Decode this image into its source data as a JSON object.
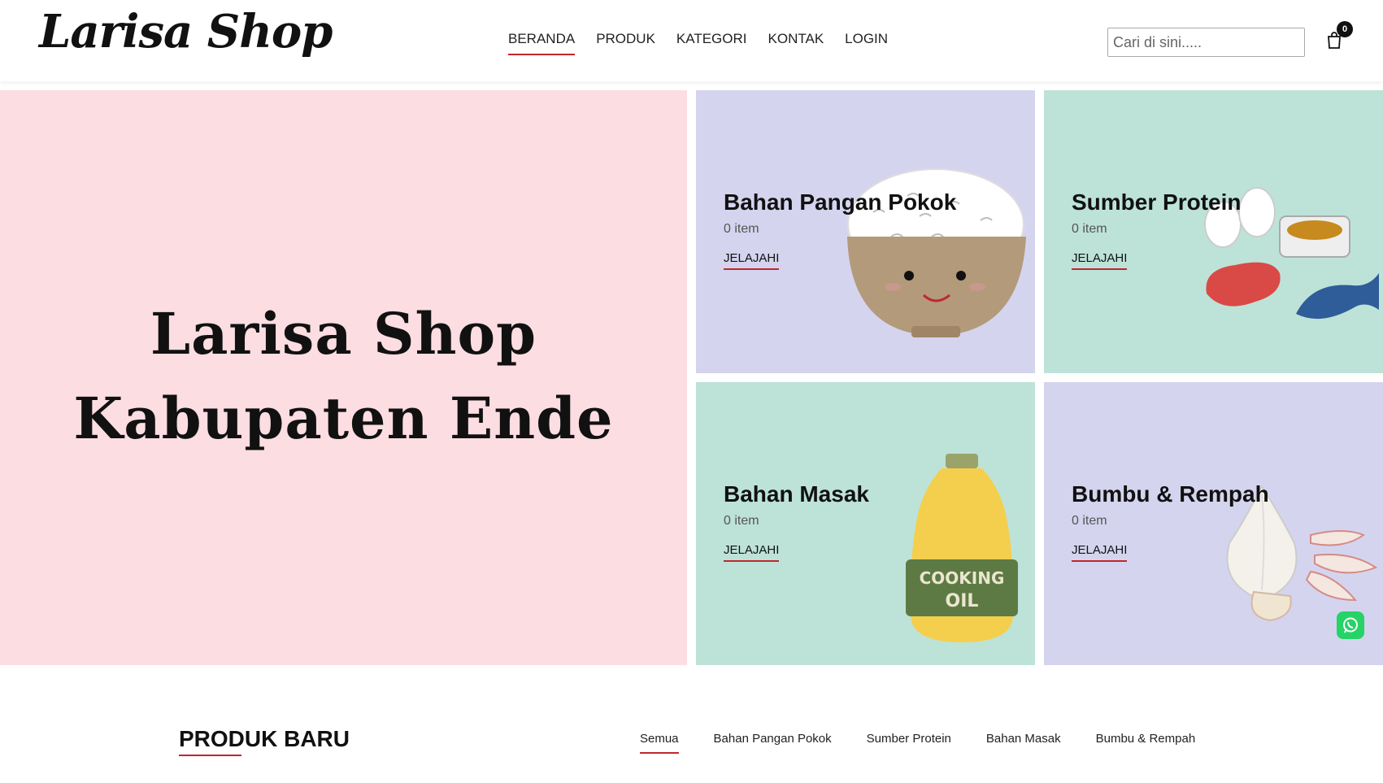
{
  "header": {
    "logo": "Larisa Shop",
    "nav": [
      "BERANDA",
      "PRODUK",
      "KATEGORI",
      "KONTAK",
      "LOGIN"
    ],
    "active_nav": "BERANDA",
    "search_placeholder": "Cari di sini.....",
    "cart_count": "0"
  },
  "hero": {
    "line1": "Larisa Shop",
    "line2": "Kabupaten Ende"
  },
  "categories": [
    {
      "title": "Bahan Pangan Pokok",
      "count": "0 item",
      "link": "JELAJAHI",
      "bg": "#d5d4ef",
      "art": "rice-bowl-icon"
    },
    {
      "title": "Sumber Protein",
      "count": "0 item",
      "link": "JELAJAHI",
      "bg": "#bde3d8",
      "art": "protein-icon"
    },
    {
      "title": "Bahan Masak",
      "count": "0 item",
      "link": "JELAJAHI",
      "bg": "#bde3d8",
      "art": "cooking-oil-icon"
    },
    {
      "title": "Bumbu & Rempah",
      "count": "0 item",
      "link": "JELAJAHI",
      "bg": "#d5d4ef",
      "art": "garlic-icon"
    }
  ],
  "cooking_oil_label": [
    "COOKING",
    "OIL"
  ],
  "products": {
    "title": "PRODUK BARU",
    "filters": [
      "Semua",
      "Bahan Pangan Pokok",
      "Sumber Protein",
      "Bahan Masak",
      "Bumbu & Rempah"
    ],
    "active_filter": "Semua"
  },
  "colors": {
    "accent": "#c0272d",
    "hero_bg": "#fbdde2",
    "whatsapp": "#25d366"
  }
}
